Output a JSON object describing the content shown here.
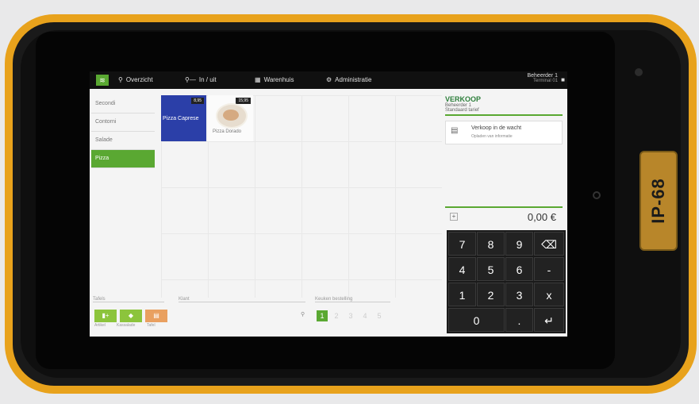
{
  "device": {
    "badge": "IP-68"
  },
  "topbar": {
    "items": [
      {
        "label": "Overzicht",
        "icon": "search-icon"
      },
      {
        "label": "In / uit",
        "icon": "key-icon"
      },
      {
        "label": "Warenhuis",
        "icon": "warehouse-icon"
      },
      {
        "label": "Administratie",
        "icon": "gear-icon"
      }
    ],
    "user": {
      "name": "Beheerder 1",
      "terminal": "Terminal 01"
    }
  },
  "categories": [
    {
      "label": "Secondi",
      "active": false
    },
    {
      "label": "Contorni",
      "active": false
    },
    {
      "label": "Salade",
      "active": false
    },
    {
      "label": "Pizza",
      "active": true
    }
  ],
  "products": [
    {
      "name": "Pizza Caprese",
      "price": "8,95"
    },
    {
      "name": "Pizza Dorado",
      "price": "15,95"
    }
  ],
  "bottom": {
    "tafels_label": "Tafels",
    "klant_label": "Klant",
    "keuken_label": "Keuken bestelling",
    "buttons": [
      {
        "label": "Artikel",
        "icon": "+"
      },
      {
        "label": "Kassalade",
        "icon": "drawer-icon"
      },
      {
        "label": "Tafel",
        "icon": "table-icon"
      }
    ],
    "pages": [
      "1",
      "2",
      "3",
      "4",
      "5"
    ]
  },
  "sale": {
    "title": "VERKOOP",
    "user": "Beheerder 1",
    "table": "Standaard tarief",
    "hold_title": "Verkoop in de wacht",
    "hold_sub": "Opladen van informatie",
    "total": "0,00 €"
  },
  "keypad": {
    "keys": [
      "7",
      "8",
      "9",
      "⌫",
      "4",
      "5",
      "6",
      "-",
      "1",
      "2",
      "3",
      "x",
      "0",
      ".",
      "↵"
    ]
  }
}
